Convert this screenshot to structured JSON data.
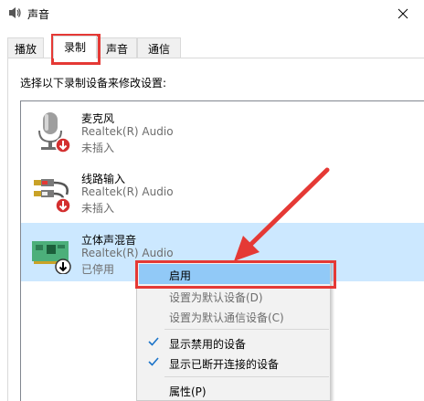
{
  "window": {
    "title": "声音"
  },
  "tabs": [
    {
      "label": "播放"
    },
    {
      "label": "录制"
    },
    {
      "label": "声音"
    },
    {
      "label": "通信"
    }
  ],
  "instruction": "选择以下录制设备来修改设置:",
  "devices": [
    {
      "name": "麦克风",
      "driver": "Realtek(R) Audio",
      "status": "未插入",
      "icon": "microphone-icon"
    },
    {
      "name": "线路输入",
      "driver": "Realtek(R) Audio",
      "status": "未插入",
      "icon": "line-in-icon"
    },
    {
      "name": "立体声混音",
      "driver": "Realtek(R) Audio",
      "status": "已停用",
      "icon": "sound-card-icon"
    }
  ],
  "context_menu": {
    "items": [
      {
        "label": "启用"
      },
      {
        "label": "设置为默认设备(D)"
      },
      {
        "label": "设置为默认通信设备(C)"
      },
      {
        "label": "显示禁用的设备"
      },
      {
        "label": "显示已断开连接的设备"
      },
      {
        "label": "属性(P)"
      }
    ]
  },
  "colors": {
    "selection": "#cce8ff",
    "menu_highlight": "#91c9f7",
    "annotation_red": "#e53935",
    "check_blue": "#1a73c9"
  }
}
